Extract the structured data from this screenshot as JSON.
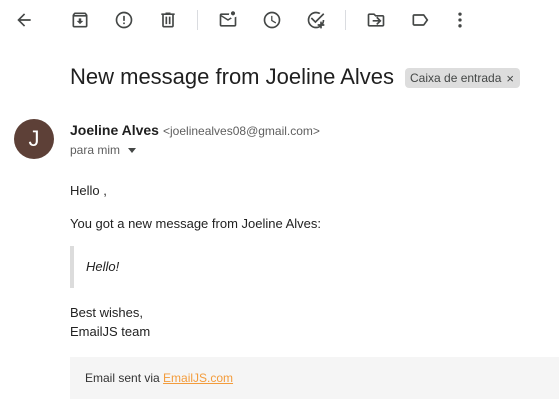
{
  "toolbar": {
    "icons": [
      "back-arrow-icon",
      "archive-icon",
      "report-spam-icon",
      "delete-icon",
      "mark-unread-icon",
      "snooze-icon",
      "add-task-icon",
      "move-to-icon",
      "label-icon",
      "more-vert-icon"
    ],
    "icon_color": "#444746"
  },
  "email": {
    "subject": "New message from Joeline Alves",
    "label_chip": "Caixa de entrada",
    "label_chip_close": "×",
    "sender": {
      "avatar_letter": "J",
      "avatar_color": "#5d4037",
      "name": "Joeline Alves",
      "email": "<joelinealves08@gmail.com>"
    },
    "recipient": "para mim",
    "body": {
      "greeting": "Hello ,",
      "intro": "You got a new message from Joeline Alves:",
      "quote": "Hello!",
      "signoff_line1": "Best wishes,",
      "signoff_line2": "EmailJS team"
    },
    "footer": {
      "prefix": "Email sent via ",
      "link_text": "EmailJS.com",
      "link_color": "#f39c3c"
    }
  }
}
